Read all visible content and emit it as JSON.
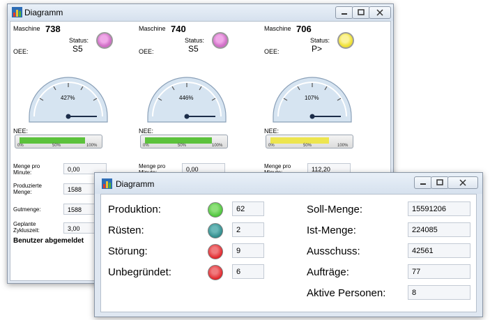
{
  "window1": {
    "title": "Diagramm",
    "machine_label": "Maschine",
    "status_label": "Status:",
    "oee_label": "OEE:",
    "nee_label": "NEE:",
    "bar_ticks": [
      "0%",
      "50%",
      "100%"
    ],
    "gauge_ticks": [
      "20%",
      "40%",
      "60%",
      "80%"
    ],
    "machines": [
      {
        "number": "738",
        "status": "S5",
        "lamp_color": "#d272c8",
        "gauge_value": "427%",
        "nee_fill": 0.82,
        "nee_color": "#5cc23c",
        "menge_pro_minute": "0,00",
        "produzierte_menge": "1588",
        "gutmenge": "1588",
        "geplante_zykluszeit": "3,00"
      },
      {
        "number": "740",
        "status": "S5",
        "lamp_color": "#d272c8",
        "gauge_value": "446%",
        "nee_fill": 0.84,
        "nee_color": "#5cc23c",
        "menge_pro_minute": "0,00"
      },
      {
        "number": "706",
        "status": "P>",
        "lamp_color": "#f0e23a",
        "gauge_value": "107%",
        "nee_fill": 0.74,
        "nee_color": "#ede54f",
        "menge_pro_minute": "112,20"
      }
    ],
    "labels": {
      "menge_pro_minute": [
        "Menge pro",
        "Minute:"
      ],
      "produzierte_menge": [
        "Produzierte",
        "Menge:"
      ],
      "gutmenge": "Gutmenge:",
      "geplante_zykluszeit": [
        "Geplante",
        "Zykluszeit:"
      ]
    },
    "footer_status": "Benutzer abgemeldet"
  },
  "window2": {
    "title": "Diagramm",
    "left_rows": [
      {
        "label": "Produktion:",
        "lamp_color": "#4dc43b",
        "value": "62"
      },
      {
        "label": "Rüsten:",
        "lamp_color": "#2f8a8a",
        "value": "2"
      },
      {
        "label": "Störung:",
        "lamp_color": "#e0262b",
        "value": "9"
      },
      {
        "label": "Unbegründet:",
        "lamp_color": "#e0262b",
        "value": "6"
      }
    ],
    "right_rows": [
      {
        "label": "Soll-Menge:",
        "value": "15591206"
      },
      {
        "label": "Ist-Menge:",
        "value": "224085"
      },
      {
        "label": "Ausschuss:",
        "value": "42561"
      },
      {
        "label": "Aufträge:",
        "value": "77"
      },
      {
        "label": "Aktive Personen:",
        "value": "8"
      }
    ]
  }
}
